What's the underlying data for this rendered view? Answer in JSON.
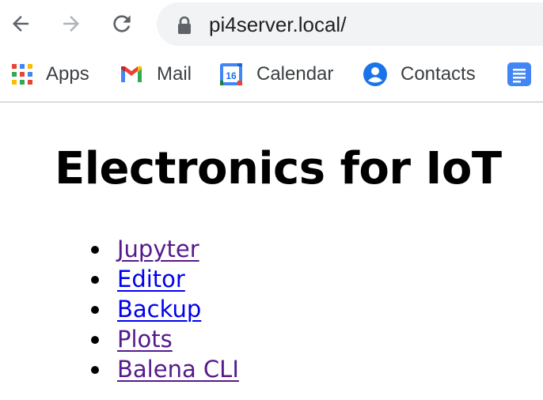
{
  "browser": {
    "url": "pi4server.local/",
    "nav": {
      "back_icon": "arrow-left-icon",
      "forward_icon": "arrow-right-icon",
      "reload_icon": "reload-icon",
      "forward_enabled": false
    },
    "bookmarks": [
      {
        "label": "Apps",
        "icon": "apps-grid-icon"
      },
      {
        "label": "Mail",
        "icon": "gmail-icon"
      },
      {
        "label": "Calendar",
        "icon": "calendar-icon",
        "icon_text": "16"
      },
      {
        "label": "Contacts",
        "icon": "contacts-icon"
      },
      {
        "label": "",
        "icon": "docs-icon"
      }
    ]
  },
  "page": {
    "title": "Electronics for IoT",
    "links": [
      {
        "label": "Jupyter",
        "state": "visited"
      },
      {
        "label": "Editor",
        "state": "unvisited"
      },
      {
        "label": "Backup",
        "state": "unvisited"
      },
      {
        "label": "Plots",
        "state": "visited"
      },
      {
        "label": "Balena CLI",
        "state": "visited"
      }
    ]
  },
  "colors": {
    "link_visited": "#551a8b",
    "link_unvisited": "#0000ee",
    "omnibox_bg": "#f1f3f4",
    "toolbar_icon": "#5f6368",
    "toolbar_icon_disabled": "#b0b3b7"
  }
}
